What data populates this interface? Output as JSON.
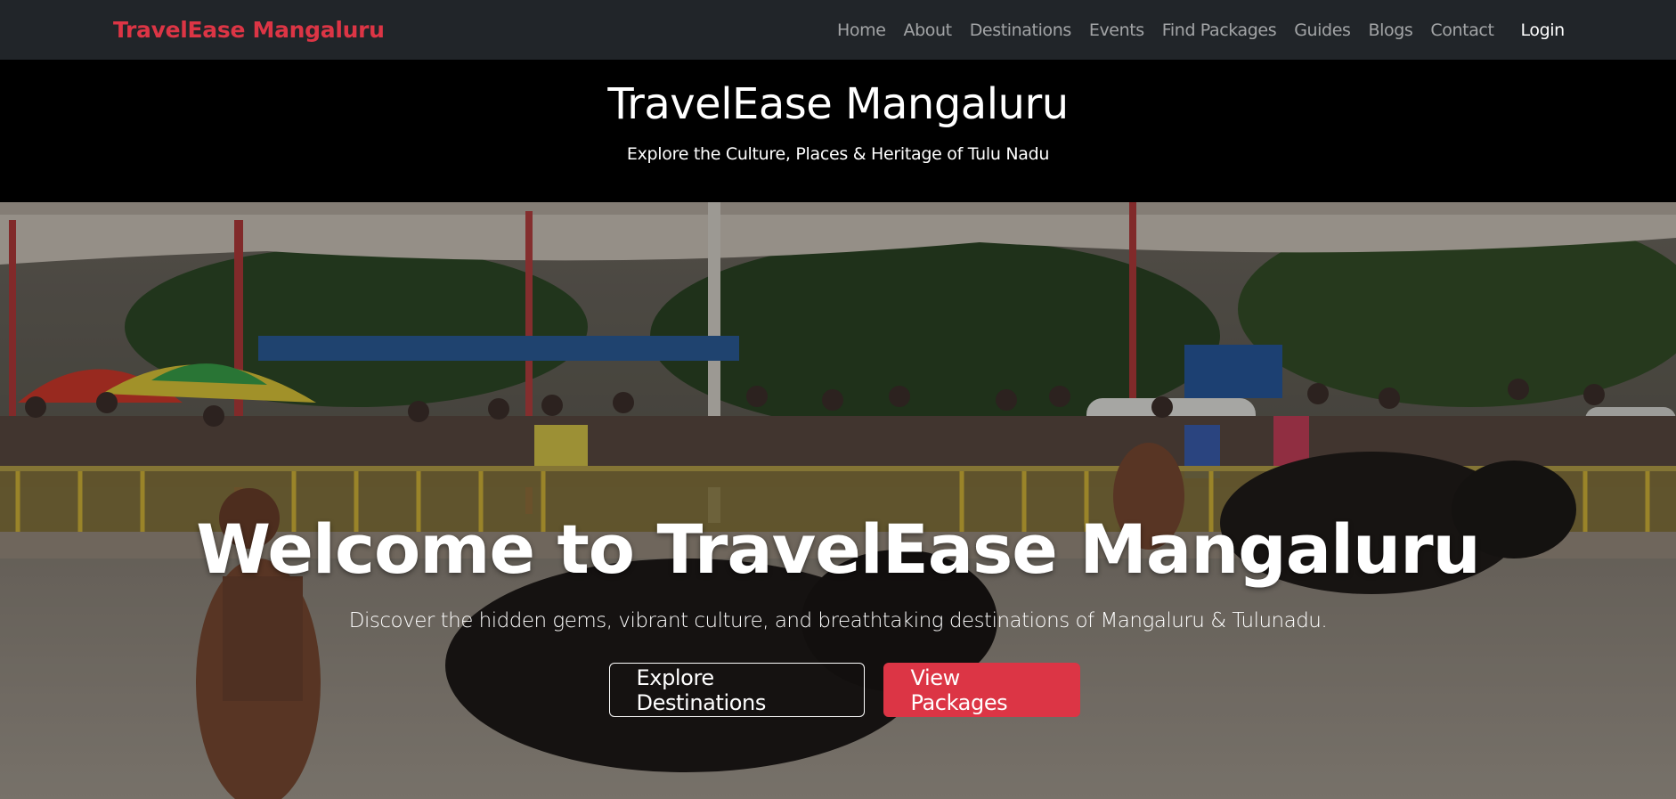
{
  "navbar": {
    "brand": "TravelEase Mangaluru",
    "links": [
      "Home",
      "About",
      "Destinations",
      "Events",
      "Find Packages",
      "Guides",
      "Blogs",
      "Contact"
    ],
    "login": "Login"
  },
  "header": {
    "title": "TravelEase Mangaluru",
    "tagline": "Explore the Culture, Places & Heritage of Tulu Nadu"
  },
  "hero": {
    "title": "Welcome to TravelEase Mangaluru",
    "subtitle": "Discover the hidden gems, vibrant culture, and breathtaking destinations of Mangaluru & Tulunadu.",
    "primary_button": "Explore Destinations",
    "secondary_button": "View Packages"
  },
  "colors": {
    "navbar_bg": "#212529",
    "brand": "#dc3545",
    "accent": "#dc3545"
  }
}
